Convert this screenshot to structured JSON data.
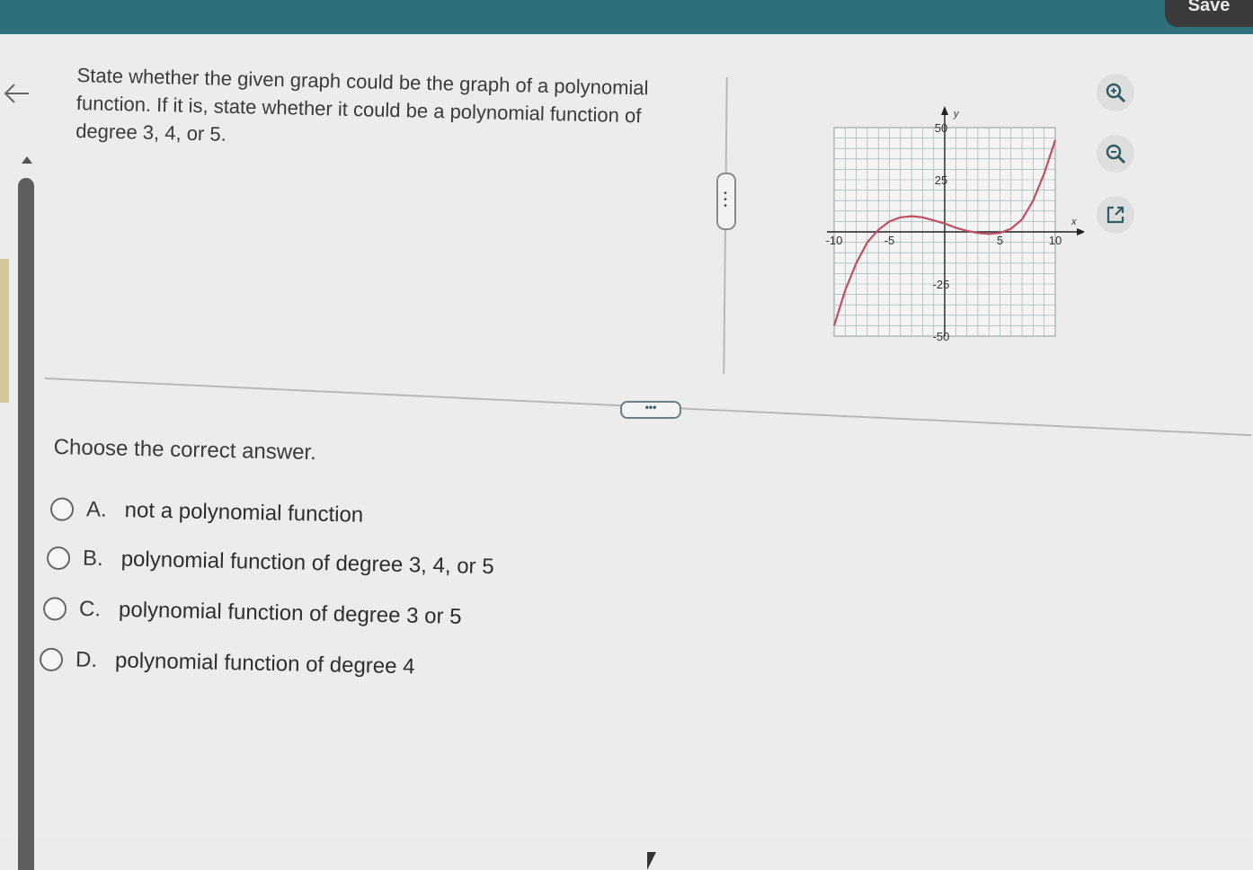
{
  "header": {
    "save_label": "Save"
  },
  "question": {
    "text": "State whether the given graph could be the graph of a polynomial function. If it is, state whether it could be a polynomial function of degree 3, 4, or 5."
  },
  "graph": {
    "x_axis_label": "x",
    "y_axis_label": "y",
    "x_ticks": [
      "-10",
      "-5",
      "5",
      "10"
    ],
    "y_ticks": [
      "50",
      "25",
      "-25",
      "-50"
    ]
  },
  "chart_data": {
    "type": "line",
    "xlabel": "x",
    "ylabel": "y",
    "xlim": [
      -10,
      10
    ],
    "ylim": [
      -50,
      50
    ],
    "grid": true,
    "series": [
      {
        "color": "#c0505f",
        "x": [
          -10,
          -9,
          -8,
          -7,
          -6,
          -5,
          -4,
          -3,
          -2,
          -1,
          0,
          1,
          2,
          3,
          4,
          5,
          6,
          7,
          8,
          9,
          10
        ],
        "y": [
          -45,
          -28,
          -15,
          -5,
          1,
          5,
          7,
          7.5,
          7,
          5.5,
          4,
          2,
          0.5,
          -0.5,
          -1,
          -0.5,
          1.5,
          6,
          15,
          28,
          44
        ]
      }
    ]
  },
  "tools": {
    "zoom_in": "zoom-in-icon",
    "zoom_out": "zoom-out-icon",
    "popout": "external-link-icon"
  },
  "prompt": "Choose the correct answer.",
  "options": [
    {
      "letter": "A.",
      "text": "not a polynomial function"
    },
    {
      "letter": "B.",
      "text": "polynomial function of degree 3, 4, or 5"
    },
    {
      "letter": "C.",
      "text": "polynomial function of degree 3 or 5"
    },
    {
      "letter": "D.",
      "text": "polynomial function of degree 4"
    }
  ],
  "colors": {
    "topbar": "#2f6e7b",
    "curve": "#c0505f"
  }
}
